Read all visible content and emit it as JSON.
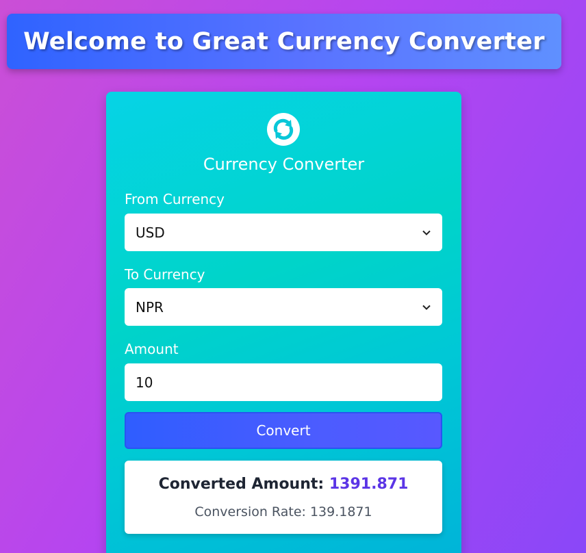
{
  "header": {
    "title": "Welcome to Great Currency Converter"
  },
  "converter": {
    "icon": "refresh-icon",
    "title": "Currency Converter",
    "from": {
      "label": "From Currency",
      "value": "USD"
    },
    "to": {
      "label": "To Currency",
      "value": "NPR"
    },
    "amount": {
      "label": "Amount",
      "value": "10"
    },
    "convert_label": "Convert",
    "result": {
      "converted_label": "Converted Amount:",
      "converted_value": "1391.871",
      "rate_label": "Conversion Rate:",
      "rate_value": "139.1871"
    }
  },
  "colors": {
    "accent": "#5b35e6",
    "card": "#00d4c9",
    "button": "#3b5cff"
  }
}
